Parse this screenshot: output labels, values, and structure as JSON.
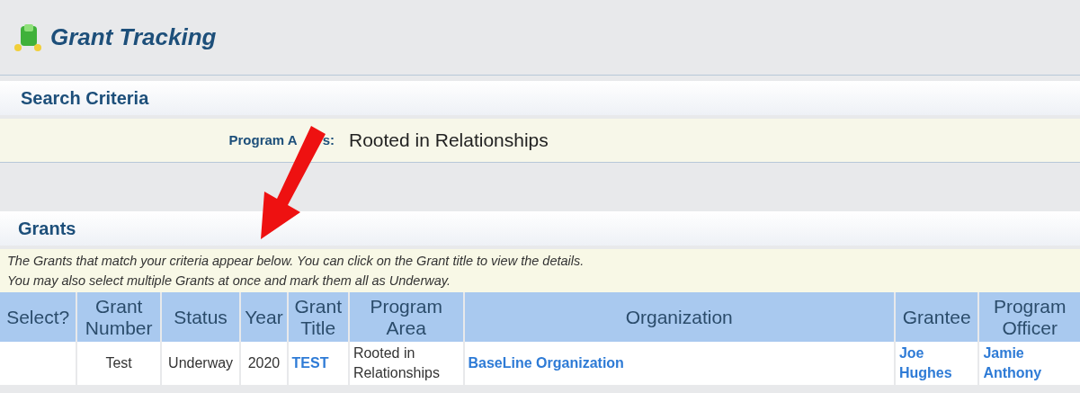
{
  "header": {
    "title": "Grant Tracking"
  },
  "search_criteria": {
    "title": "Search Criteria",
    "field": {
      "label_parts": [
        "Program A",
        "s:"
      ],
      "value": "Rooted in Relationships"
    }
  },
  "grants": {
    "title": "Grants",
    "description": [
      "The Grants that match your criteria appear below. You can click on the Grant title to view the details.",
      "You may also select multiple Grants at once and mark them all as Underway."
    ],
    "table": {
      "columns": [
        "Select?",
        "Grant Number",
        "Status",
        "Year",
        "Grant Title",
        "Program Area",
        "Organization",
        "Grantee",
        "Program Officer"
      ],
      "rows": [
        {
          "cells": [
            {
              "kind": "empty"
            },
            {
              "kind": "text",
              "lines": [
                "Test"
              ]
            },
            {
              "kind": "text",
              "lines": [
                "Underway"
              ]
            },
            {
              "kind": "text",
              "lines": [
                "2020"
              ]
            },
            {
              "kind": "link",
              "lines": [
                "TEST"
              ]
            },
            {
              "kind": "text",
              "lines": [
                "Rooted in",
                "Relationships"
              ]
            },
            {
              "kind": "link",
              "lines": [
                "BaseLine Organization"
              ]
            },
            {
              "kind": "link",
              "lines": [
                "Joe",
                "Hughes"
              ]
            },
            {
              "kind": "link",
              "lines": [
                "Jamie",
                "Anthony"
              ]
            }
          ]
        }
      ]
    }
  }
}
